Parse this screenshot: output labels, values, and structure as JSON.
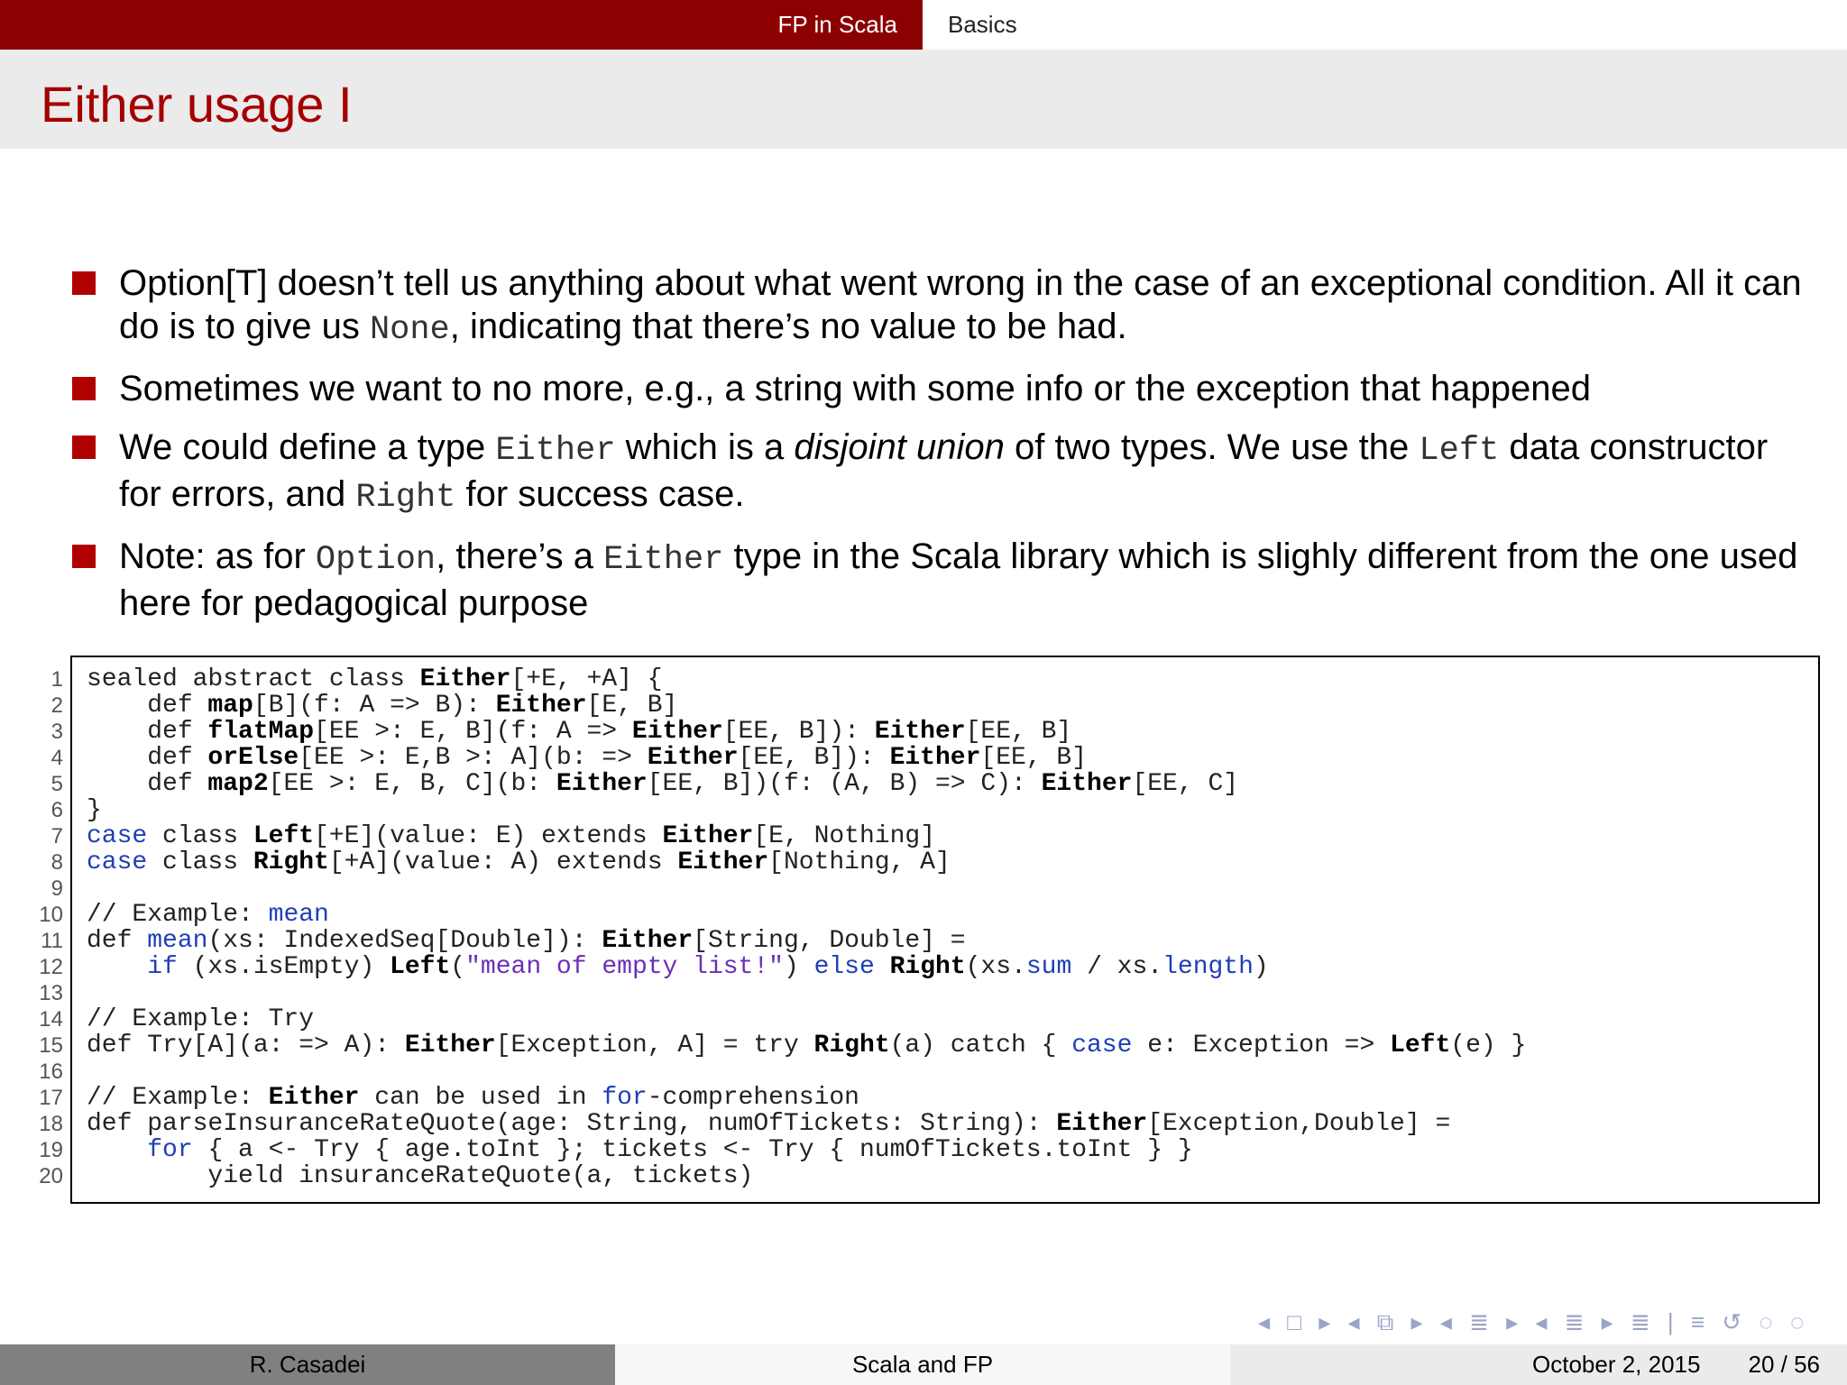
{
  "header": {
    "section": "FP in Scala",
    "subsection": "Basics"
  },
  "slide": {
    "title": "Either usage I"
  },
  "bullets": [
    {
      "p1": "Option[T] doesn’t tell us anything about what went wrong in the case of an exceptional condition. All it can do is to give us ",
      "c1": "None",
      "p2": ", indicating that there’s no value to be had."
    },
    {
      "p1": "Sometimes we want to no more, e.g., a string with some info or the exception that happened"
    },
    {
      "p1": "We could define a type ",
      "c1": "Either",
      "p2": " which is a ",
      "em": "disjoint union",
      "p3": " of two types. We use the ",
      "c2": "Left",
      "p4": " data constructor for errors, and ",
      "c3": "Right",
      "p5": " for success case."
    },
    {
      "p1": "Note: as for ",
      "c1": "Option",
      "p2": ", there’s a ",
      "c2": "Either",
      "p3": " type in the Scala library which is slighly different from the one used here for pedagogical purpose"
    }
  ],
  "code": {
    "line_numbers": [
      "1",
      "2",
      "3",
      "4",
      "5",
      "6",
      "7",
      "8",
      "9",
      "10",
      "11",
      "12",
      "13",
      "14",
      "15",
      "16",
      "17",
      "18",
      "19",
      "20"
    ],
    "lines": [
      [
        [
          "t",
          "sealed abstract class "
        ],
        [
          "b",
          "Either"
        ],
        [
          "t",
          "[+E, +A] {"
        ]
      ],
      [
        [
          "t",
          "    def "
        ],
        [
          "b",
          "map"
        ],
        [
          "t",
          "[B](f: A => B): "
        ],
        [
          "b",
          "Either"
        ],
        [
          "t",
          "[E, B]"
        ]
      ],
      [
        [
          "t",
          "    def "
        ],
        [
          "b",
          "flatMap"
        ],
        [
          "t",
          "[EE >: E, B](f: A => "
        ],
        [
          "b",
          "Either"
        ],
        [
          "t",
          "[EE, B]): "
        ],
        [
          "b",
          "Either"
        ],
        [
          "t",
          "[EE, B]"
        ]
      ],
      [
        [
          "t",
          "    def "
        ],
        [
          "b",
          "orElse"
        ],
        [
          "t",
          "[EE >: E,B >: A](b: => "
        ],
        [
          "b",
          "Either"
        ],
        [
          "t",
          "[EE, B]): "
        ],
        [
          "b",
          "Either"
        ],
        [
          "t",
          "[EE, B]"
        ]
      ],
      [
        [
          "t",
          "    def "
        ],
        [
          "b",
          "map2"
        ],
        [
          "t",
          "[EE >: E, B, C](b: "
        ],
        [
          "b",
          "Either"
        ],
        [
          "t",
          "[EE, B])(f: (A, B) => C): "
        ],
        [
          "b",
          "Either"
        ],
        [
          "t",
          "[EE, C]"
        ]
      ],
      [
        [
          "t",
          "}"
        ]
      ],
      [
        [
          "k",
          "case"
        ],
        [
          "t",
          " class "
        ],
        [
          "b",
          "Left"
        ],
        [
          "t",
          "[+E](value: E) extends "
        ],
        [
          "b",
          "Either"
        ],
        [
          "t",
          "[E, Nothing]"
        ]
      ],
      [
        [
          "k",
          "case"
        ],
        [
          "t",
          " class "
        ],
        [
          "b",
          "Right"
        ],
        [
          "t",
          "[+A](value: A) extends "
        ],
        [
          "b",
          "Either"
        ],
        [
          "t",
          "[Nothing, A]"
        ]
      ],
      [],
      [
        [
          "t",
          "// Example: "
        ],
        [
          "k",
          "mean"
        ]
      ],
      [
        [
          "t",
          "def "
        ],
        [
          "k",
          "mean"
        ],
        [
          "t",
          "(xs: IndexedSeq[Double]): "
        ],
        [
          "b",
          "Either"
        ],
        [
          "t",
          "[String, Double] ="
        ]
      ],
      [
        [
          "t",
          "    "
        ],
        [
          "k",
          "if"
        ],
        [
          "t",
          " (xs.isEmpty) "
        ],
        [
          "b",
          "Left"
        ],
        [
          "t",
          "("
        ],
        [
          "s",
          "\"mean of empty list!\""
        ],
        [
          "t",
          ") "
        ],
        [
          "k",
          "else"
        ],
        [
          "t",
          " "
        ],
        [
          "b",
          "Right"
        ],
        [
          "t",
          "(xs."
        ],
        [
          "k",
          "sum"
        ],
        [
          "t",
          " / xs."
        ],
        [
          "k",
          "length"
        ],
        [
          "t",
          ")"
        ]
      ],
      [],
      [
        [
          "t",
          "// Example: Try"
        ]
      ],
      [
        [
          "t",
          "def Try[A](a: => A): "
        ],
        [
          "b",
          "Either"
        ],
        [
          "t",
          "[Exception, A] = try "
        ],
        [
          "b",
          "Right"
        ],
        [
          "t",
          "(a) catch { "
        ],
        [
          "k",
          "case"
        ],
        [
          "t",
          " e: Exception => "
        ],
        [
          "b",
          "Left"
        ],
        [
          "t",
          "(e) }"
        ]
      ],
      [],
      [
        [
          "t",
          "// Example: "
        ],
        [
          "b",
          "Either"
        ],
        [
          "t",
          " can be used in "
        ],
        [
          "k",
          "for"
        ],
        [
          "t",
          "-comprehension"
        ]
      ],
      [
        [
          "t",
          "def parseInsuranceRateQuote(age: String, numOfTickets: String): "
        ],
        [
          "b",
          "Either"
        ],
        [
          "t",
          "[Exception,Double] ="
        ]
      ],
      [
        [
          "t",
          "    "
        ],
        [
          "k",
          "for"
        ],
        [
          "t",
          " { a <- Try { age.toInt }; tickets <- Try { numOfTickets.toInt } }"
        ]
      ],
      [
        [
          "t",
          "        yield insuranceRateQuote(a, tickets)"
        ]
      ]
    ]
  },
  "nav": {
    "icons": "◂ □ ▸ ◂ ⧉ ▸ ◂ ≣ ▸ ◂ ≣ ▸ ≣ | ≡ ↺ ◌ ◌"
  },
  "footer": {
    "author": "R. Casadei",
    "talk": "Scala and FP",
    "date": "October 2, 2015",
    "page": "20 / 56"
  },
  "colors": {
    "header_red": "#8b0000",
    "title_red": "#a50000",
    "bullet_red": "#b00000",
    "keyword_blue": "#1f3fb7",
    "string_purple": "#6b2fb8"
  }
}
